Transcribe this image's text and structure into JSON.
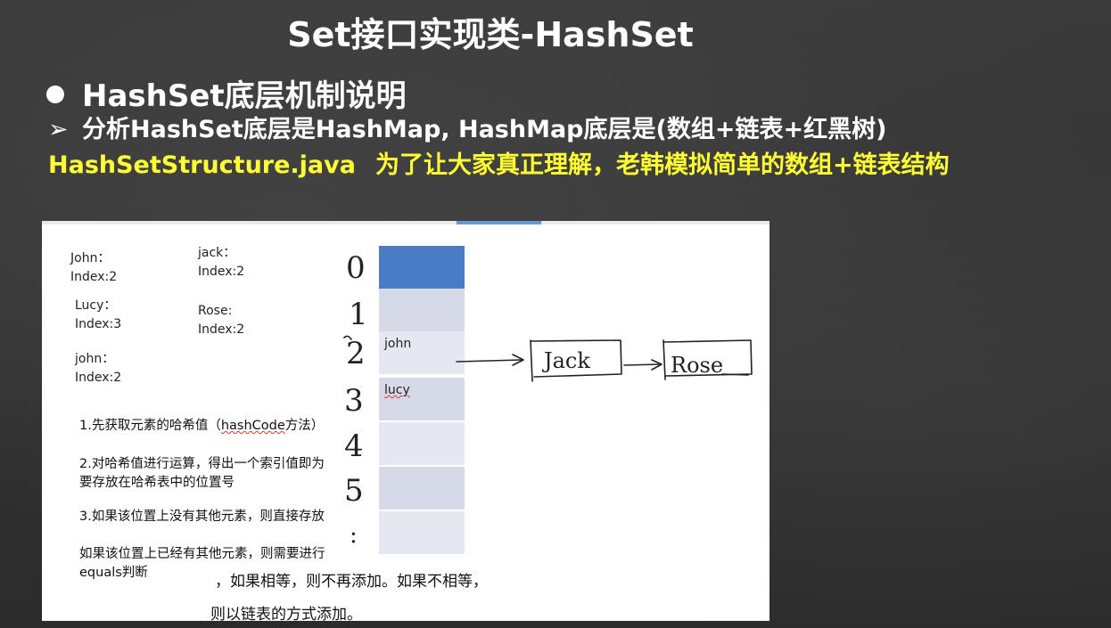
{
  "slide": {
    "title": "Set接口实现类-HashSet",
    "bullet": "HashSet底层机制说明",
    "sub_arrow": "➢",
    "sub": "分析HashSet底层是HashMap, HashMap底层是(数组+链表+红黑树)",
    "file_name": "HashSetStructure.java",
    "file_desc": "为了让大家真正理解，老韩模拟简单的数组+链表结构"
  },
  "diagram": {
    "notes": [
      {
        "name": "John",
        "text": "John：\nIndex:2"
      },
      {
        "name": "jack",
        "text": "jack：\nIndex:2"
      },
      {
        "name": "Lucy",
        "text": "Lucy：\nIndex:3"
      },
      {
        "name": "Rose",
        "text": "Rose:\nIndex:2"
      },
      {
        "name": "john",
        "text": "john：\nIndex:2"
      }
    ],
    "steps": {
      "s1a": "1.先获取元素的哈希值（",
      "s1b": "hashCode",
      "s1c": "方法）",
      "s2": "2.对哈希值进行运算，得出一个索引值即为要存放在哈希表中的位置号",
      "s3": "3.如果该位置上没有其他元素，则直接存放",
      "s4": "如果该位置上已经有其他元素，则需要进行equals判断"
    },
    "bottom1": "，如果相等，则不再添加。如果不相等，",
    "bottom2": "则以链表的方式添加。",
    "indices": [
      "0",
      "1",
      "2",
      "3",
      "4",
      "5",
      ":"
    ],
    "table_cells": [
      "",
      "",
      "john",
      "lucy",
      "",
      "",
      ""
    ],
    "chain": [
      "Jack",
      "Rose"
    ],
    "colors": {
      "cell_blue": "#4a7cc5",
      "cell_light": "#d6d9e8",
      "cell_pale": "#e6e8f1",
      "yellow": "#ffff33"
    }
  }
}
